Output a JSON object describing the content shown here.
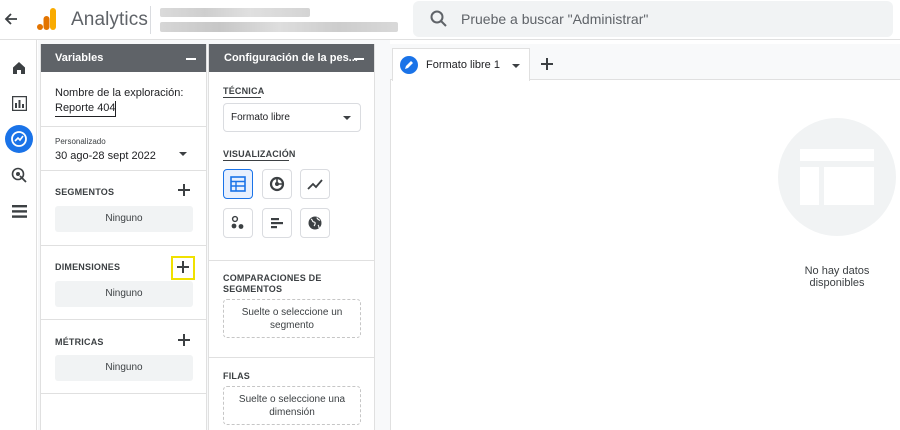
{
  "header": {
    "app_title": "Analytics",
    "search_placeholder": "Pruebe a buscar \"Administrar\""
  },
  "nav": {
    "items": [
      "home-icon",
      "reports-icon",
      "explore-icon",
      "advertising-icon",
      "configure-icon"
    ],
    "active": "explore-icon"
  },
  "variables_panel": {
    "title": "Variables",
    "exploration_name_label": "Nombre de la exploración:",
    "exploration_name_value": "Reporte 404",
    "date_badge": "Personalizado",
    "date_range": "30 ago-28 sept 2022",
    "segments_label": "SEGMENTOS",
    "segments_value": "Ninguno",
    "dimensions_label": "DIMENSIONES",
    "dimensions_value": "Ninguno",
    "metrics_label": "MÉTRICAS",
    "metrics_value": "Ninguno"
  },
  "settings_panel": {
    "title": "Configuración de la pes...",
    "technique_label": "TÉCNICA",
    "technique_value": "Formato libre",
    "visualization_label": "VISUALIZACIÓN",
    "visualizations": [
      "table-icon",
      "donut-chart-icon",
      "line-chart-icon",
      "scatter-icon",
      "bar-chart-icon",
      "globe-icon"
    ],
    "selected_visualization": "table-icon",
    "segment_comparisons_label_1": "COMPARACIONES DE",
    "segment_comparisons_label_2": "SEGMENTOS",
    "segment_drop_1": "Suelte o seleccione un",
    "segment_drop_2": "segmento",
    "rows_label": "FILAS",
    "rows_drop_1": "Suelte o seleccione una",
    "rows_drop_2": "dimensión"
  },
  "canvas": {
    "tab_label": "Formato libre 1",
    "empty_line_1": "No hay datos",
    "empty_line_2": "disponibles"
  },
  "colors": {
    "accent": "#1a73e8",
    "panel_header": "#5f6368",
    "highlight": "#f0e100",
    "logo_orange": "#f9ab00",
    "logo_dark_orange": "#e37400"
  }
}
